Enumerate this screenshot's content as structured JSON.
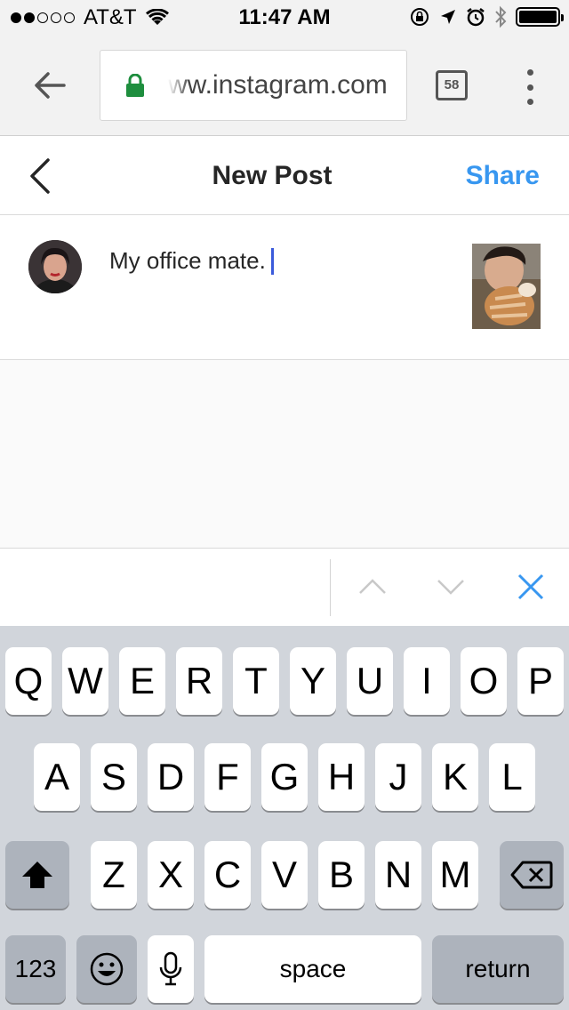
{
  "status_bar": {
    "carrier": "AT&T",
    "time": "11:47 AM"
  },
  "browser": {
    "url": "ww.instagram.com",
    "tab_count": "58"
  },
  "header": {
    "title": "New Post",
    "share_label": "Share"
  },
  "compose": {
    "caption": "My office mate."
  },
  "keyboard": {
    "row1": [
      "Q",
      "W",
      "E",
      "R",
      "T",
      "Y",
      "U",
      "I",
      "O",
      "P"
    ],
    "row2": [
      "A",
      "S",
      "D",
      "F",
      "G",
      "H",
      "J",
      "K",
      "L"
    ],
    "row3": [
      "Z",
      "X",
      "C",
      "V",
      "B",
      "N",
      "M"
    ],
    "numbers_label": "123",
    "space_label": "space",
    "return_label": "return"
  },
  "colors": {
    "share_blue": "#3897f0",
    "lock_green": "#1e8e3e",
    "cursor": "#3b5bdb"
  }
}
